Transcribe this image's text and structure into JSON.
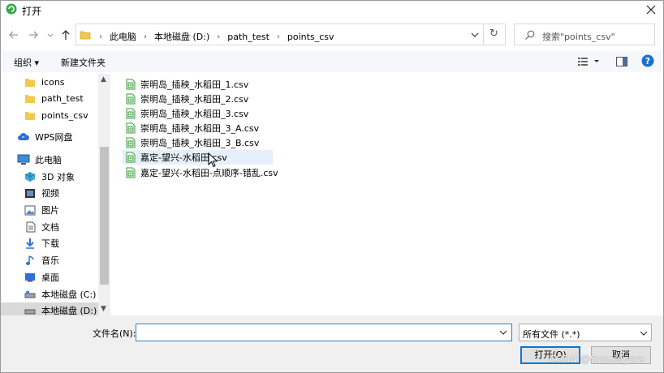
{
  "titlebar": {
    "title": "打开",
    "close": "✕"
  },
  "nav": {
    "back": "←",
    "forward": "→",
    "recent": "⌄",
    "up": "↑"
  },
  "address": {
    "breadcrumbs": [
      "此电脑",
      "本地磁盘 (D:)",
      "path_test",
      "points_csv"
    ],
    "separator": "›",
    "refresh": "↻"
  },
  "search": {
    "placeholder": "搜索\"points_csv\""
  },
  "toolbar": {
    "organize": "组织 ▾",
    "new_folder": "新建文件夹",
    "help": "?"
  },
  "sidebar": {
    "items": [
      {
        "label": "icons",
        "icon": "folder-icon"
      },
      {
        "label": "path_test",
        "icon": "folder-icon"
      },
      {
        "label": "points_csv",
        "icon": "folder-icon"
      },
      {
        "label": "WPS网盘",
        "icon": "cloud-icon"
      },
      {
        "label": "此电脑",
        "icon": "computer-icon"
      },
      {
        "label": "3D 对象",
        "icon": "3d-objects-icon"
      },
      {
        "label": "视频",
        "icon": "video-icon"
      },
      {
        "label": "图片",
        "icon": "pictures-icon"
      },
      {
        "label": "文档",
        "icon": "documents-icon"
      },
      {
        "label": "下载",
        "icon": "downloads-icon"
      },
      {
        "label": "音乐",
        "icon": "music-icon"
      },
      {
        "label": "桌面",
        "icon": "desktop-icon"
      },
      {
        "label": "本地磁盘 (C:)",
        "icon": "drive-icon"
      },
      {
        "label": "本地磁盘 (D:)",
        "icon": "drive-icon"
      }
    ]
  },
  "files": [
    "崇明岛_插秧_水稻田_1.csv",
    "崇明岛_插秧_水稻田_2.csv",
    "崇明岛_插秧_水稻田_3.csv",
    "崇明岛_插秧_水稻田_3_A.csv",
    "崇明岛_插秧_水稻田_3_B.csv",
    "嘉定-望兴-水稻田.csv",
    "嘉定-望兴-水稻田-点顺序-错乱.csv"
  ],
  "bottom": {
    "filename_label": "文件名(N):",
    "filename_value": "",
    "filter_value": "所有文件 (*.*)",
    "open_label": "打开(O)",
    "cancel_label": "取消",
    "watermark": "CSDN @Snaplayers"
  },
  "colors": {
    "accent": "#0078d7",
    "folder": "#f2c94c",
    "csv_icon": "#3a9b3a"
  }
}
